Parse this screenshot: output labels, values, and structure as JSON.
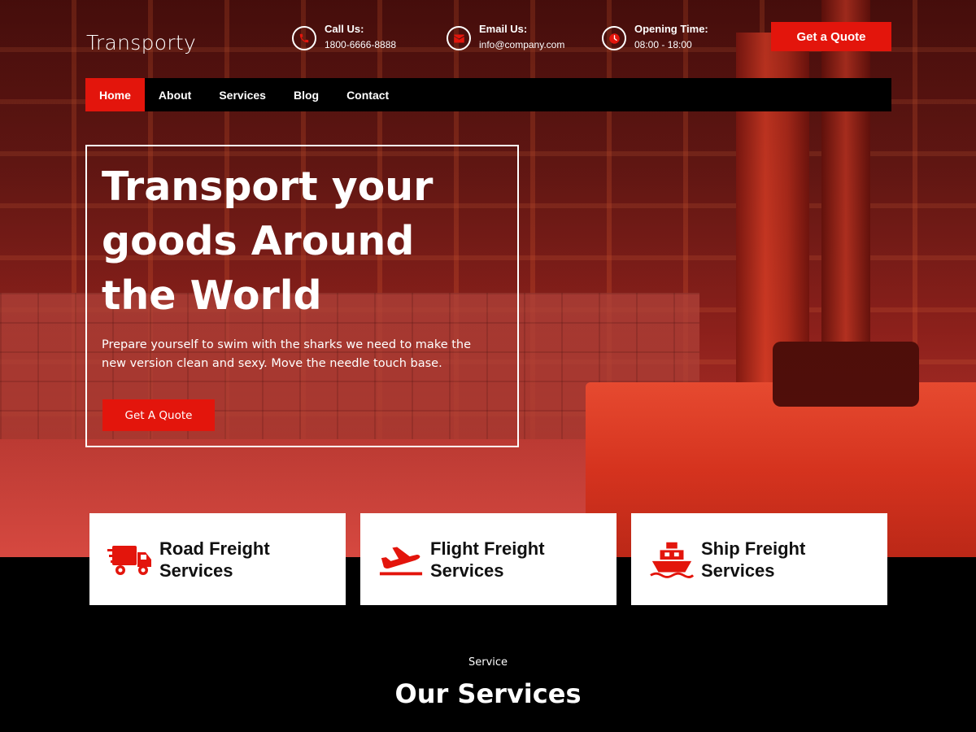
{
  "colors": {
    "accent": "#e3150c",
    "nav_bg": "#000000",
    "card_bg": "#ffffff"
  },
  "header": {
    "logo": "Transporty",
    "contacts": [
      {
        "icon": "phone-icon",
        "label": "Call Us:",
        "value": "1800-6666-8888"
      },
      {
        "icon": "email-icon",
        "label": "Email Us:",
        "value": "info@company.com"
      },
      {
        "icon": "clock-icon",
        "label": "Opening Time:",
        "value": "08:00 - 18:00"
      }
    ],
    "quote_button": "Get a Quote"
  },
  "nav": {
    "items": [
      {
        "label": "Home",
        "active": true
      },
      {
        "label": "About",
        "active": false
      },
      {
        "label": "Services",
        "active": false
      },
      {
        "label": "Blog",
        "active": false
      },
      {
        "label": "Contact",
        "active": false
      }
    ]
  },
  "hero": {
    "title": "Transport your goods Around the World",
    "text": "Prepare yourself to swim with the sharks we need to make the new version clean and sexy. Move the needle touch base.",
    "button": "Get A Quote"
  },
  "cards": [
    {
      "icon": "truck-icon",
      "title": "Road Freight Services"
    },
    {
      "icon": "airplane-icon",
      "title": "Flight Freight Services"
    },
    {
      "icon": "ship-icon",
      "title": "Ship Freight Services"
    }
  ],
  "services_section": {
    "label": "Service",
    "title": "Our Services"
  }
}
